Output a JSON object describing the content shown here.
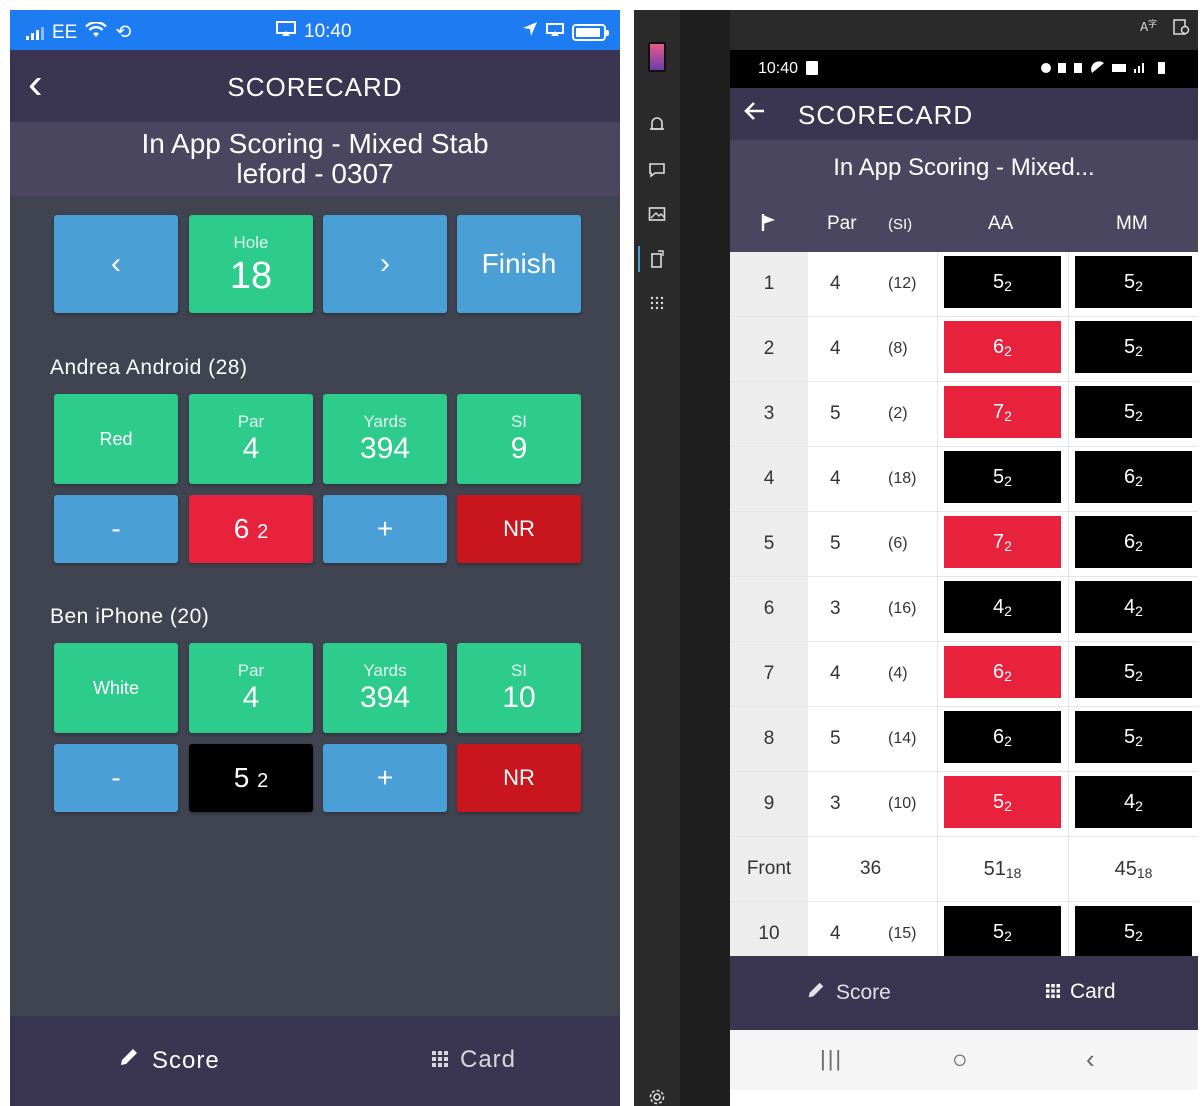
{
  "ios": {
    "status": {
      "carrier": "EE",
      "time": "10:40"
    },
    "header": {
      "back": "‹",
      "title": "SCORECARD"
    },
    "competition": "In App Scoring - Mixed Stab\nleford - 0307",
    "nav": {
      "prev": "‹",
      "hole_label": "Hole",
      "hole_value": "18",
      "next": "›",
      "finish": "Finish"
    },
    "players": [
      {
        "name": "Andrea Android (28)",
        "tee": "Red",
        "par_label": "Par",
        "par": "4",
        "yards_label": "Yards",
        "yards": "394",
        "si_label": "SI",
        "si": "9",
        "minus": "-",
        "score": "6",
        "points": "2",
        "plus": "+",
        "nr": "NR",
        "score_color": "#e8213c"
      },
      {
        "name": "Ben iPhone (20)",
        "tee": "White",
        "par_label": "Par",
        "par": "4",
        "yards_label": "Yards",
        "yards": "394",
        "si_label": "SI",
        "si": "10",
        "minus": "-",
        "score": "5",
        "points": "2",
        "plus": "+",
        "nr": "NR",
        "score_color": "#000000"
      }
    ],
    "tabs": {
      "score": "Score",
      "card": "Card"
    }
  },
  "android": {
    "status": {
      "time": "10:40"
    },
    "header": {
      "title": "SCORECARD"
    },
    "competition": "In App Scoring - Mixed...",
    "columns": {
      "par": "Par",
      "si": "(SI)",
      "p1": "AA",
      "p2": "MM"
    },
    "rows": [
      {
        "hole": "1",
        "par": "4",
        "si": "(12)",
        "aa": "5",
        "aa_pts": "2",
        "aa_color": "#000000",
        "mm": "5",
        "mm_pts": "2",
        "mm_color": "#000000"
      },
      {
        "hole": "2",
        "par": "4",
        "si": "(8)",
        "aa": "6",
        "aa_pts": "2",
        "aa_color": "#e8213c",
        "mm": "5",
        "mm_pts": "2",
        "mm_color": "#000000"
      },
      {
        "hole": "3",
        "par": "5",
        "si": "(2)",
        "aa": "7",
        "aa_pts": "2",
        "aa_color": "#e8213c",
        "mm": "5",
        "mm_pts": "2",
        "mm_color": "#000000"
      },
      {
        "hole": "4",
        "par": "4",
        "si": "(18)",
        "aa": "5",
        "aa_pts": "2",
        "aa_color": "#000000",
        "mm": "6",
        "mm_pts": "2",
        "mm_color": "#000000"
      },
      {
        "hole": "5",
        "par": "5",
        "si": "(6)",
        "aa": "7",
        "aa_pts": "2",
        "aa_color": "#e8213c",
        "mm": "6",
        "mm_pts": "2",
        "mm_color": "#000000"
      },
      {
        "hole": "6",
        "par": "3",
        "si": "(16)",
        "aa": "4",
        "aa_pts": "2",
        "aa_color": "#000000",
        "mm": "4",
        "mm_pts": "2",
        "mm_color": "#000000"
      },
      {
        "hole": "7",
        "par": "4",
        "si": "(4)",
        "aa": "6",
        "aa_pts": "2",
        "aa_color": "#e8213c",
        "mm": "5",
        "mm_pts": "2",
        "mm_color": "#000000"
      },
      {
        "hole": "8",
        "par": "5",
        "si": "(14)",
        "aa": "6",
        "aa_pts": "2",
        "aa_color": "#000000",
        "mm": "5",
        "mm_pts": "2",
        "mm_color": "#000000"
      },
      {
        "hole": "9",
        "par": "3",
        "si": "(10)",
        "aa": "5",
        "aa_pts": "2",
        "aa_color": "#e8213c",
        "mm": "4",
        "mm_pts": "2",
        "mm_color": "#000000"
      }
    ],
    "front": {
      "label": "Front",
      "par": "36",
      "aa": "51",
      "aa_pts": "18",
      "mm": "45",
      "mm_pts": "18"
    },
    "row10": {
      "hole": "10",
      "par": "4",
      "si": "(15)",
      "aa": "5",
      "aa_pts": "2",
      "aa_color": "#000000",
      "mm": "5",
      "mm_pts": "2",
      "mm_color": "#000000"
    },
    "tabs": {
      "score": "Score",
      "card": "Card"
    },
    "nav": {
      "recents": "|||",
      "home": "○",
      "back": "‹"
    }
  }
}
